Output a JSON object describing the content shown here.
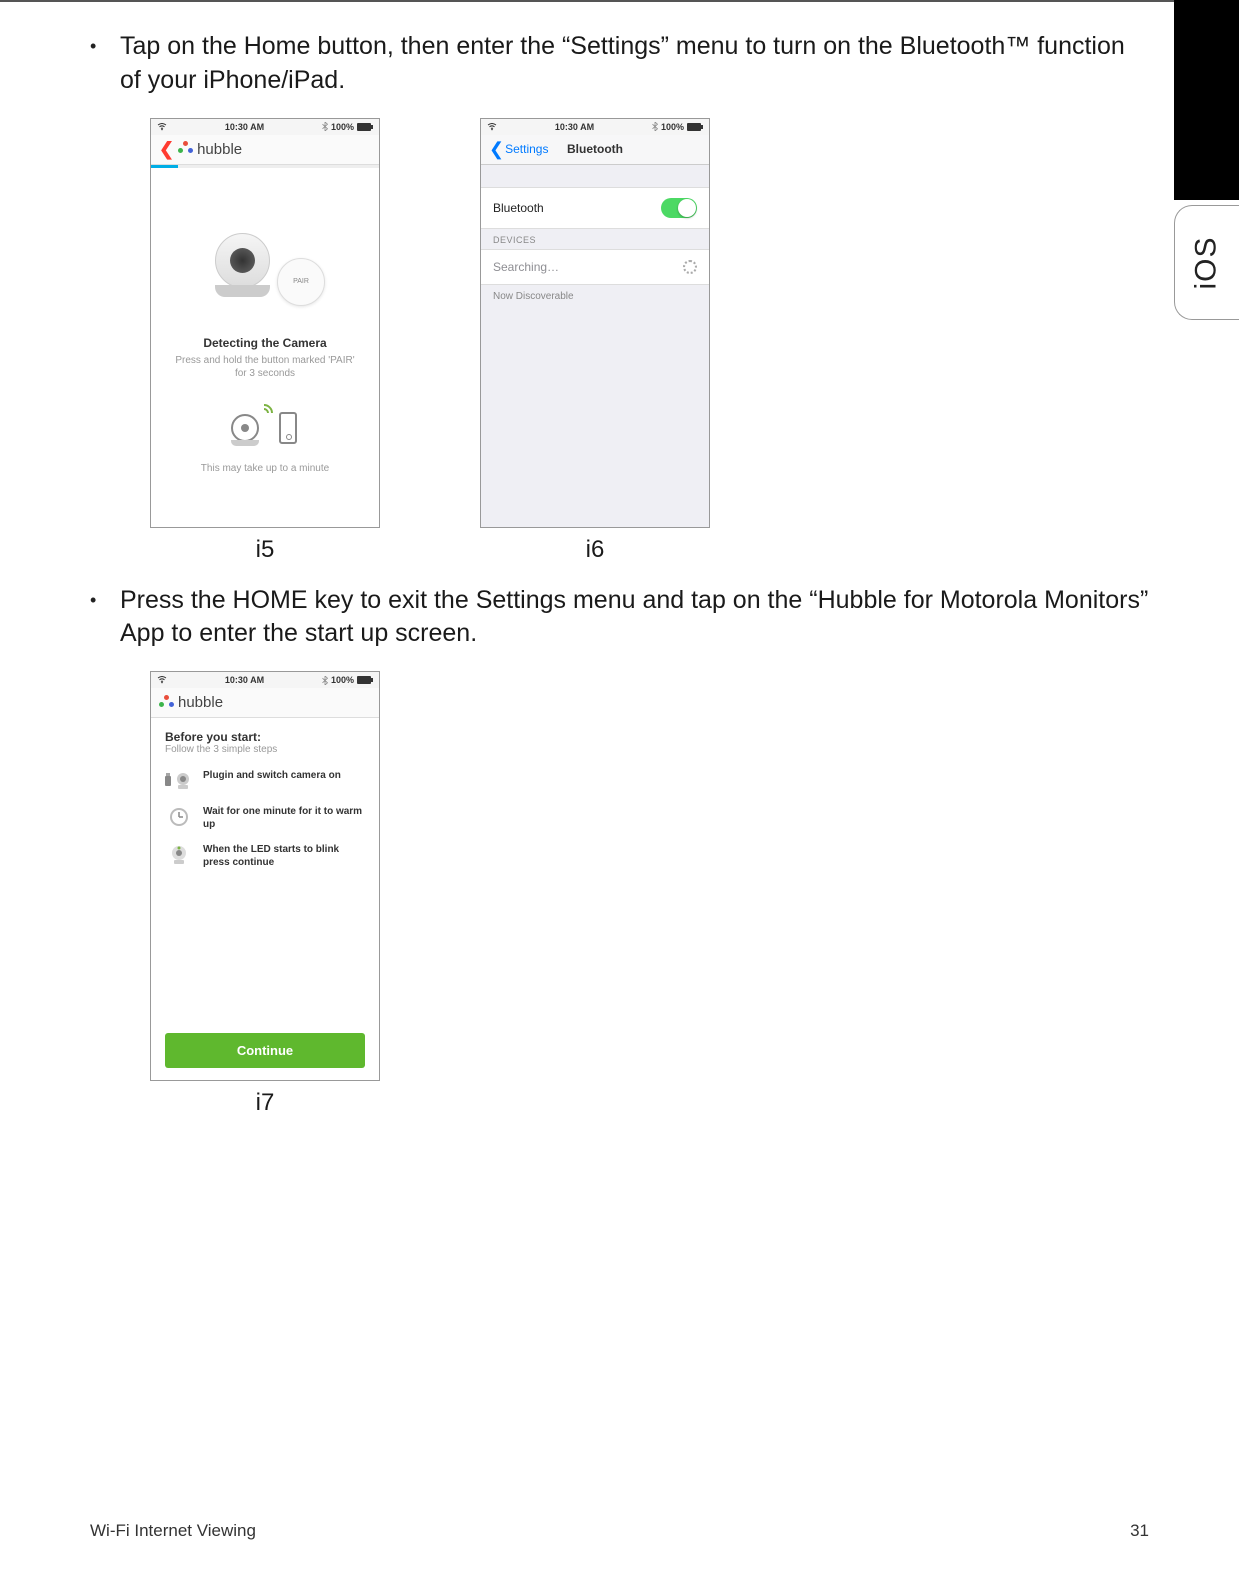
{
  "bullets": {
    "b1": "Tap on the Home button, then enter the “Settings” menu to turn on the Bluetooth™ function of your iPhone/iPad.",
    "b2": "Press the HOME key to exit the Settings menu and tap on the “Hubble for Motorola Monitors” App to enter the start up screen."
  },
  "captions": {
    "i5": "i5",
    "i6": "i6",
    "i7": "i7"
  },
  "side_tab": "iOS",
  "status": {
    "time": "10:30 AM",
    "battery": "100%"
  },
  "i5": {
    "app_name": "hubble",
    "pair_label": "PAIR",
    "title": "Detecting the Camera",
    "subtitle": "Press and hold the button marked 'PAIR' for 3 seconds",
    "footer": "This may take up to a minute"
  },
  "i6": {
    "back": "Settings",
    "title": "Bluetooth",
    "row_label": "Bluetooth",
    "section": "DEVICES",
    "searching": "Searching…",
    "discoverable": "Now Discoverable"
  },
  "i7": {
    "app_name": "hubble",
    "heading": "Before you start:",
    "sub": "Follow the 3 simple steps",
    "steps": {
      "s1": "Plugin and switch camera on",
      "s2": "Wait for one minute for it to warm up",
      "s3": "When the LED starts to blink press continue"
    },
    "continue": "Continue"
  },
  "footer": {
    "left": "Wi-Fi Internet Viewing",
    "right": "31"
  }
}
